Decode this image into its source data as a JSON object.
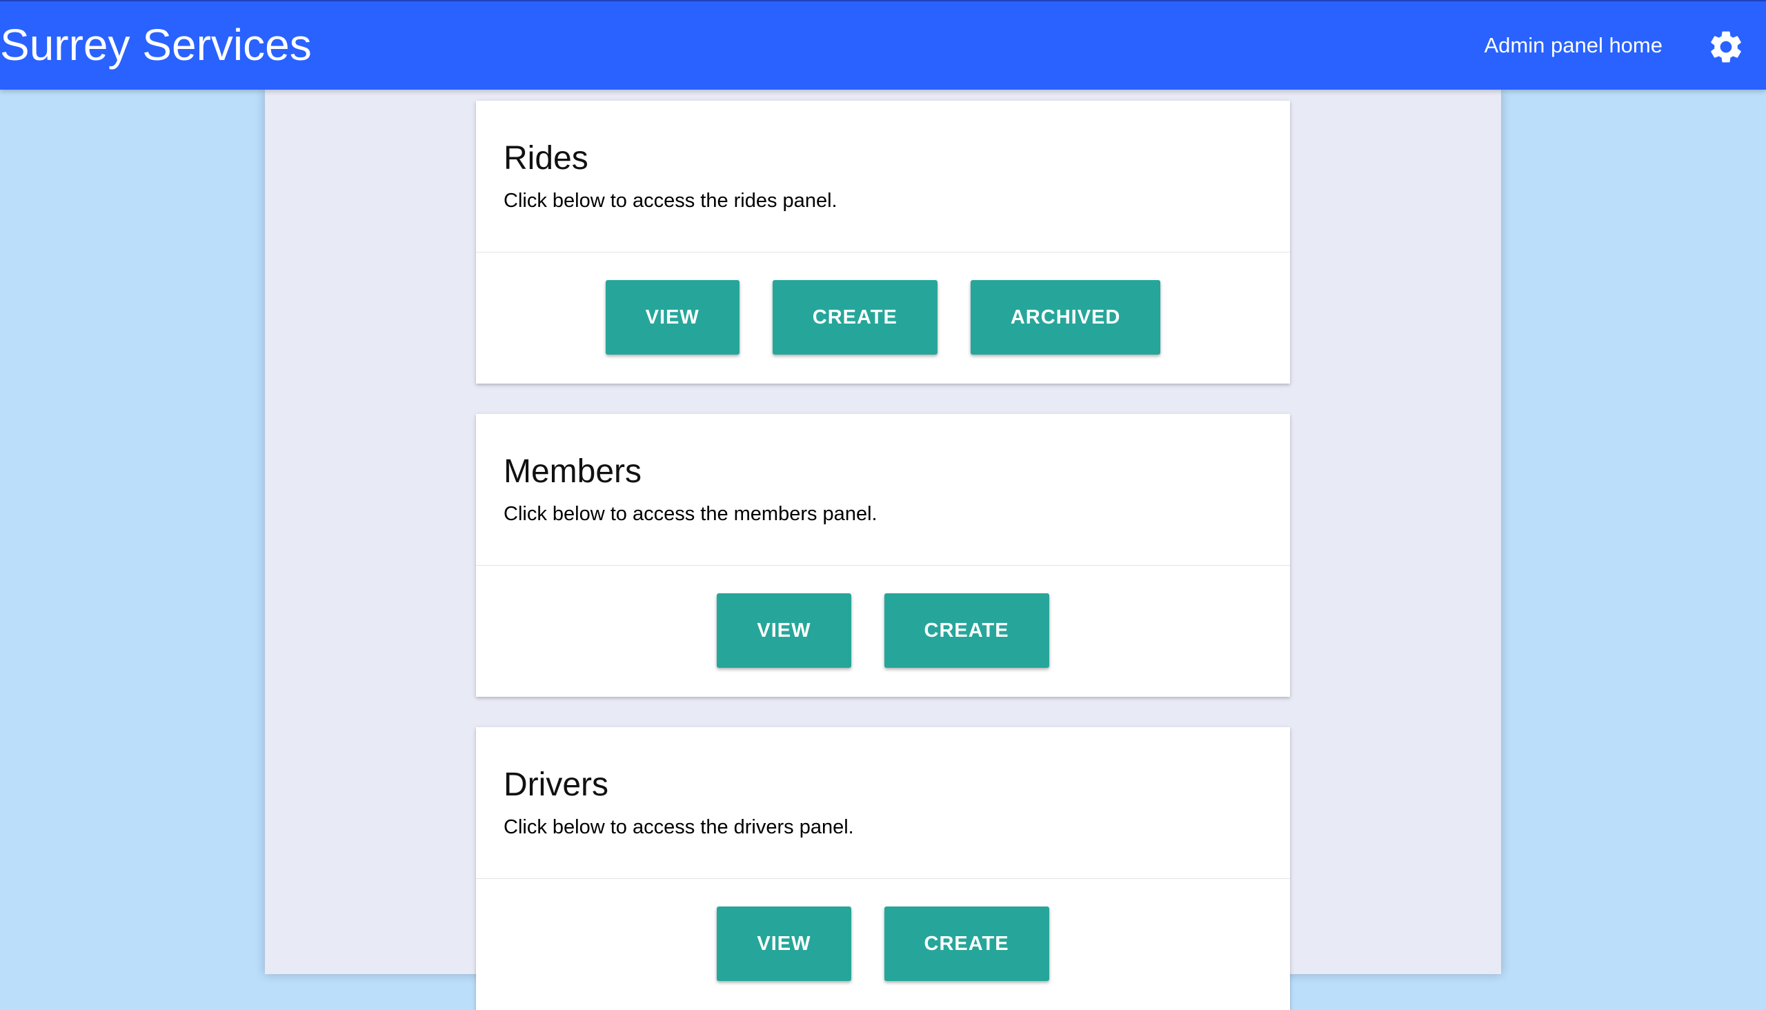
{
  "header": {
    "brand": "Surrey Services",
    "nav_link": "Admin panel home",
    "settings_icon": "gear-icon",
    "background_color": "#2962ff"
  },
  "panels": [
    {
      "title": "Rides",
      "description": "Click below to access the rides panel.",
      "buttons": [
        "VIEW",
        "CREATE",
        "ARCHIVED"
      ]
    },
    {
      "title": "Members",
      "description": "Click below to access the members panel.",
      "buttons": [
        "VIEW",
        "CREATE"
      ]
    },
    {
      "title": "Drivers",
      "description": "Click below to access the drivers panel.",
      "buttons": [
        "VIEW",
        "CREATE"
      ]
    }
  ],
  "colors": {
    "page_background": "#bbdefb",
    "content_background": "#e8eaf6",
    "button": "#26a69a"
  }
}
